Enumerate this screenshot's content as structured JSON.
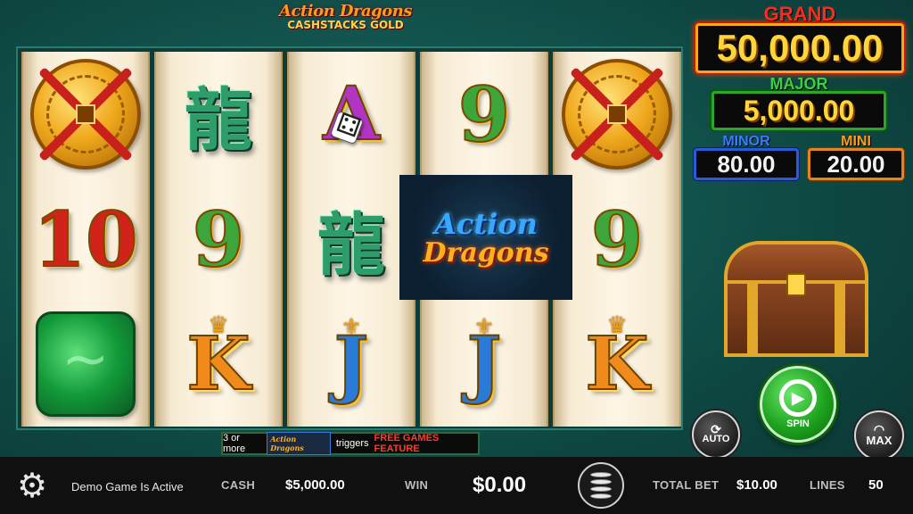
{
  "logo": {
    "line1": "Action Dragons",
    "line2": "CASHSTACKS GOLD"
  },
  "jackpots": {
    "grand": {
      "label": "GRAND",
      "value": "50,000.00",
      "color": "#ff2a1a"
    },
    "major": {
      "label": "MAJOR",
      "value": "5,000.00",
      "color": "#39d23a"
    },
    "minor": {
      "label": "MINOR",
      "value": "80.00",
      "color": "#3a7aff"
    },
    "mini": {
      "label": "MINI",
      "value": "20.00",
      "color": "#ff9a1a"
    }
  },
  "reels": {
    "r1": {
      "top": "coin-icon",
      "middle": "10",
      "bottom": "jade-dragon-icon"
    },
    "r2": {
      "top": "龍",
      "middle": "9",
      "bottom": "K"
    },
    "r3": {
      "top": "A",
      "middle": "龍",
      "bottom": "J"
    },
    "r4": {
      "top": "9",
      "middle_logo_line1": "Action",
      "middle_logo_line2": "Dragons",
      "bottom": "J"
    },
    "r5": {
      "top": "coin-icon",
      "middle": "9",
      "bottom": "K"
    }
  },
  "feature_banner": {
    "prefix": "3 or more",
    "mini_logo": "Action Dragons",
    "middle": "triggers",
    "highlight": "FREE GAMES FEATURE"
  },
  "buttons": {
    "spin": "SPIN",
    "auto": "AUTO",
    "max": "MAX"
  },
  "bottom_bar": {
    "status": "Demo Game Is Active",
    "cash_label": "CASH",
    "cash_value": "$5,000.00",
    "win_label": "WIN",
    "win_value": "$0.00",
    "total_bet_label": "TOTAL BET",
    "total_bet_value": "$10.00",
    "lines_label": "LINES",
    "lines_value": "50"
  },
  "icons": [
    "gear-icon",
    "coin-stack-icon",
    "treasure-chest-icon",
    "spin-arrow-icon"
  ]
}
